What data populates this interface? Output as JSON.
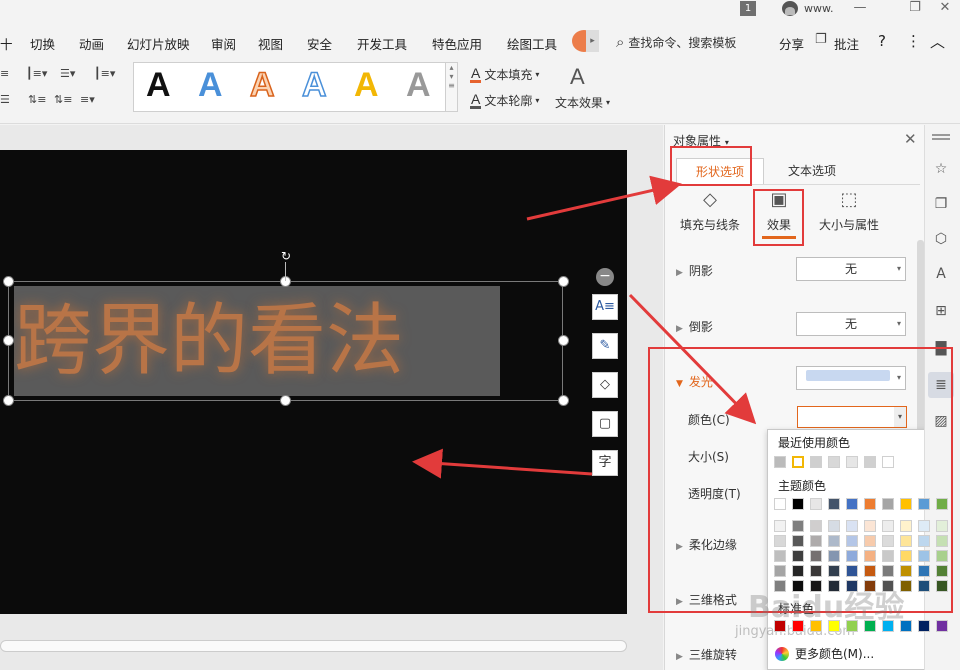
{
  "titlebar": {
    "badge": "1",
    "username": "www.",
    "buttons": [
      "—",
      "❐",
      "✕"
    ]
  },
  "menu": {
    "items": [
      "十",
      "切换",
      "动画",
      "幻灯片放映",
      "审阅",
      "视图",
      "安全",
      "开发工具",
      "特色应用",
      "绘图工具"
    ],
    "search": "查找命令、搜索模板",
    "share": "分享",
    "comment": "批注",
    "help": "?",
    "more": "⋮",
    "collapse": "︿"
  },
  "ribbon": {
    "text_fill": "文本填充",
    "text_outline": "文本轮廓",
    "text_effects": "文本效果",
    "gallery": [
      {
        "letter": "A",
        "color": "#111111"
      },
      {
        "letter": "A",
        "color": "#4a90d9"
      },
      {
        "letter": "A",
        "color": "#f08a3c"
      },
      {
        "letter": "A",
        "color": "#ffffff"
      },
      {
        "letter": "A",
        "color": "#f2b705"
      },
      {
        "letter": "A",
        "color": "#999999"
      }
    ]
  },
  "slide": {
    "text": "跨界的看法"
  },
  "pane": {
    "title": "对象属性",
    "tabs": {
      "shape": "形状选项",
      "text": "文本选项"
    },
    "subtabs": {
      "fill": "填充与线条",
      "effect": "效果",
      "size": "大小与属性"
    },
    "rows": {
      "shadow": "阴影",
      "shadow_value": "无",
      "reflection": "倒影",
      "reflection_value": "无",
      "glow": "发光",
      "color": "颜色(C)",
      "size": "大小(S)",
      "transparency": "透明度(T)",
      "soft_edges": "柔化边缘",
      "format3d": "三维格式",
      "rotation3d": "三维旋转"
    }
  },
  "color_picker": {
    "recent_heading": "最近使用颜色",
    "recent": [
      "#bbbbbb",
      "#ffffff",
      "#cfcfcf",
      "#d8d8d8",
      "#e6e6e6",
      "#d0d0d0",
      "#ffffff"
    ],
    "theme_heading": "主题颜色",
    "theme_top": [
      "#ffffff",
      "#000000",
      "#e7e6e6",
      "#44546a",
      "#4472c4",
      "#ed7d31",
      "#a5a5a5",
      "#ffc000",
      "#5b9bd5",
      "#70ad47"
    ],
    "theme_shades": [
      [
        "#f2f2f2",
        "#7f7f7f",
        "#d0cece",
        "#d6dce4",
        "#d9e2f3",
        "#fbe5d5",
        "#ededed",
        "#fff2cc",
        "#deebf6",
        "#e2efd9"
      ],
      [
        "#d8d8d8",
        "#595959",
        "#aeabab",
        "#adb9ca",
        "#b4c6e7",
        "#f7cbac",
        "#dbdbdb",
        "#fee599",
        "#bdd7ee",
        "#c5e0b3"
      ],
      [
        "#bfbfbf",
        "#3f3f3f",
        "#757070",
        "#8496b0",
        "#8eaadb",
        "#f4b183",
        "#c9c9c9",
        "#ffd965",
        "#9dc3e6",
        "#a8d08d"
      ],
      [
        "#a5a5a5",
        "#262626",
        "#3a3838",
        "#323f4f",
        "#2f5496",
        "#c55a11",
        "#7b7b7b",
        "#bf9000",
        "#2e75b5",
        "#538135"
      ],
      [
        "#7f7f7f",
        "#0c0c0c",
        "#171616",
        "#222a35",
        "#1f3864",
        "#833c0b",
        "#525252",
        "#7f6000",
        "#1e4e79",
        "#375623"
      ]
    ],
    "standard_heading": "标准色",
    "standard": [
      "#c00000",
      "#ff0000",
      "#ffc000",
      "#ffff00",
      "#92d050",
      "#00b050",
      "#00b0f0",
      "#0070c0",
      "#002060",
      "#7030a0"
    ],
    "more_colors": "更多颜色(M)..."
  },
  "watermark": {
    "text": "Baidu经验",
    "url": "jingyan.baidu.com"
  },
  "colors": {
    "accent": "#e2661c",
    "annotation": "#e23b3b"
  }
}
